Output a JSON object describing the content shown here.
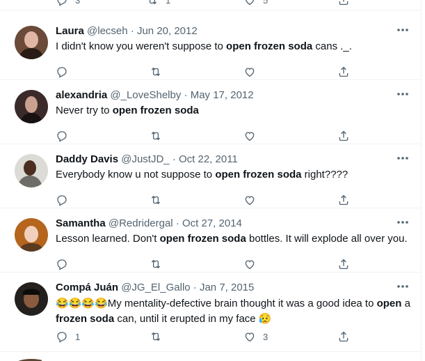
{
  "top_counts": {
    "reply": "3",
    "retweet": "1",
    "like": "5"
  },
  "tweets": [
    {
      "name": "Laura",
      "handle": "@lecseh",
      "sep": "·",
      "date": "Jun 20, 2012",
      "text": [
        "I didn't know you weren't suppose to ",
        "open frozen soda",
        " cans ._."
      ],
      "reply_count": "",
      "retweet_count": "",
      "like_count": "",
      "avatar_colors": [
        "#6b4a3a",
        "#e0b7a4",
        "#2a1b14"
      ]
    },
    {
      "name": "alexandria",
      "handle": "@_LoveShelby",
      "sep": "·",
      "date": "May 17, 2012",
      "text": [
        "Never try to ",
        "open frozen soda",
        ""
      ],
      "reply_count": "",
      "retweet_count": "",
      "like_count": "",
      "avatar_colors": [
        "#3b2a2a",
        "#caa18f",
        "#171111"
      ]
    },
    {
      "name": "Daddy Davis",
      "handle": "@JustJD_",
      "sep": "·",
      "date": "Oct 22, 2011",
      "text": [
        "Everybody know u not suppose to ",
        "open frozen soda",
        " right????"
      ],
      "reply_count": "",
      "retweet_count": "",
      "like_count": "",
      "avatar_colors": [
        "#6e6d68",
        "#4a2e1f",
        "#dcdbd6"
      ]
    },
    {
      "name": "Samantha",
      "handle": "@Redridergal",
      "sep": "·",
      "date": "Oct 27, 2014",
      "text": [
        "Lesson learned. Don't ",
        "open frozen soda",
        " bottles. It will explode all over you."
      ],
      "reply_count": "",
      "retweet_count": "",
      "like_count": "",
      "avatar_colors": [
        "#b5651d",
        "#f1d1bd",
        "#5a3b22"
      ]
    },
    {
      "name": "Compá Juán",
      "handle": "@JG_El_Gallo",
      "sep": "·",
      "date": "Jan 7, 2015",
      "emoji_line": "😂😂😂😂",
      "text": [
        "My mentality-defective brain thought it was a good idea to ",
        "open",
        " a ",
        "frozen soda",
        " can, until it erupted in my face ",
        "😥"
      ],
      "reply_count": "1",
      "retweet_count": "",
      "like_count": "3",
      "avatar_colors": [
        "#23201d",
        "#8a5b3f",
        "#0c0b0a"
      ]
    }
  ],
  "icons": {
    "reply": "reply-icon",
    "retweet": "retweet-icon",
    "like": "like-icon",
    "share": "share-icon",
    "more": "more-icon"
  },
  "colors": {
    "muted": "#536471",
    "text": "#0f1419",
    "border": "#eff3f4"
  }
}
